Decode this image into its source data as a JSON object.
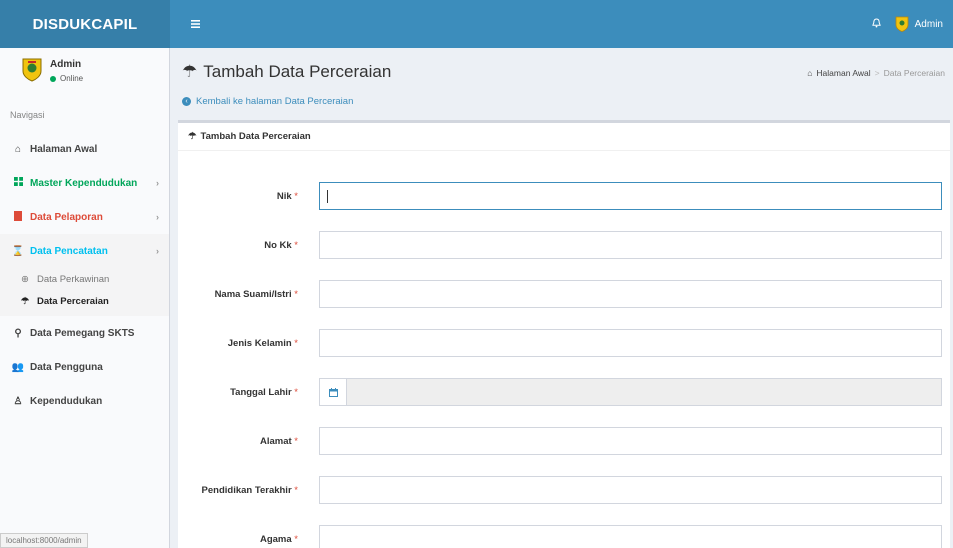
{
  "header": {
    "logo": "DISDUKCAPIL",
    "user": "Admin"
  },
  "sidebar": {
    "user_name": "Admin",
    "status": "Online",
    "nav_header": "Navigasi",
    "items": [
      {
        "label": "Halaman Awal"
      },
      {
        "label": "Master Kependudukan"
      },
      {
        "label": "Data Pelaporan"
      },
      {
        "label": "Data Pencatatan"
      },
      {
        "label": "Data Pemegang SKTS"
      },
      {
        "label": "Data Pengguna"
      },
      {
        "label": "Kependudukan"
      }
    ],
    "sub_items": [
      {
        "label": "Data Perkawinan"
      },
      {
        "label": "Data Perceraian"
      }
    ],
    "status_url": "localhost:8000/admin"
  },
  "page": {
    "title": "Tambah Data Perceraian",
    "back_link": "Kembali ke halaman Data Perceraian",
    "breadcrumb": {
      "home": "Halaman Awal",
      "current": "Data Perceraian"
    }
  },
  "form": {
    "box_title": "Tambah Data Perceraian",
    "required_mark": "*",
    "fields": [
      {
        "label": "Nik"
      },
      {
        "label": "No Kk"
      },
      {
        "label": "Nama Suami/Istri"
      },
      {
        "label": "Jenis Kelamin"
      },
      {
        "label": "Tanggal Lahir"
      },
      {
        "label": "Alamat"
      },
      {
        "label": "Pendidikan Terakhir"
      },
      {
        "label": "Agama"
      }
    ]
  },
  "colors": {
    "header": "#3c8dbc",
    "logo_bg": "#367fa9",
    "online": "#00a65a"
  }
}
